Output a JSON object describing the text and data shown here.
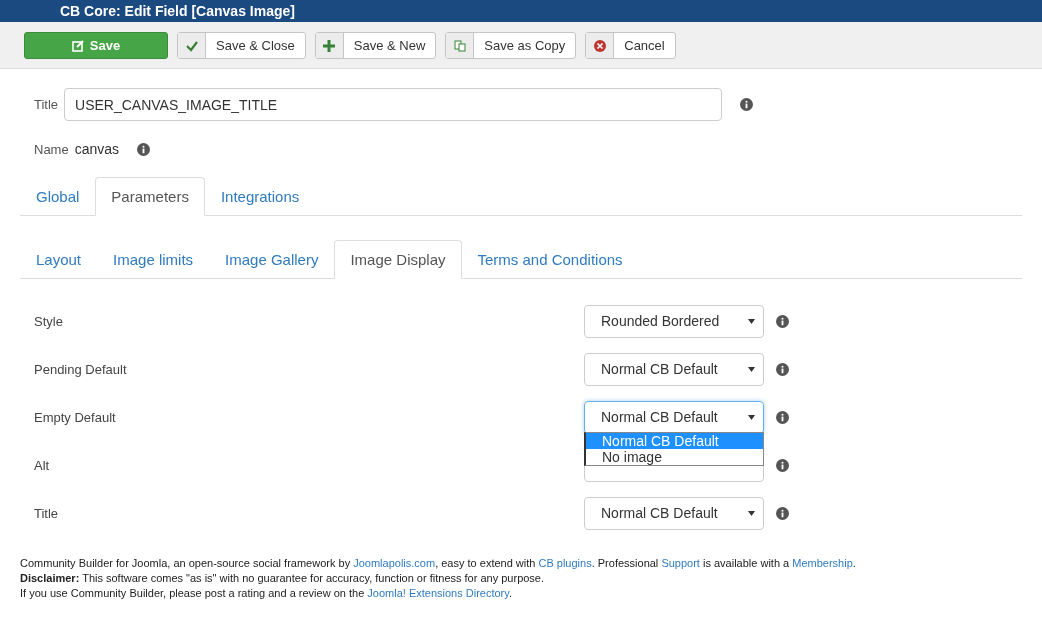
{
  "window": {
    "title": "CB Core: Edit Field [Canvas Image]"
  },
  "toolbar": [
    {
      "label": "Save",
      "kind": "primary"
    },
    {
      "label": "Save & Close",
      "kind": "check"
    },
    {
      "label": "Save & New",
      "kind": "plus"
    },
    {
      "label": "Save as Copy",
      "kind": "copy"
    },
    {
      "label": "Cancel",
      "kind": "cancel"
    }
  ],
  "title_field": {
    "label": "Title",
    "value": "USER_CANVAS_IMAGE_TITLE"
  },
  "name": {
    "label": "Name",
    "value": "canvas"
  },
  "tabs": [
    {
      "label": "Global",
      "selected": false
    },
    {
      "label": "Parameters",
      "selected": true
    },
    {
      "label": "Integrations",
      "selected": false
    }
  ],
  "subtabs": [
    {
      "label": "Layout",
      "selected": false
    },
    {
      "label": "Image limits",
      "selected": false
    },
    {
      "label": "Image Gallery",
      "selected": false
    },
    {
      "label": "Image Display",
      "selected": true
    },
    {
      "label": "Terms and Conditions",
      "selected": false
    }
  ],
  "fields": [
    {
      "label": "Style",
      "value": "Rounded Bordered",
      "focused": false
    },
    {
      "label": "Pending Default",
      "value": "Normal CB Default",
      "focused": false
    },
    {
      "label": "Empty Default",
      "value": "Normal CB Default",
      "focused": true,
      "options": [
        {
          "label": "Normal CB Default",
          "selected": true
        },
        {
          "label": "No image",
          "selected": false
        }
      ]
    },
    {
      "label": "Alt",
      "focused": false
    },
    {
      "label": "Title",
      "value": "Normal CB Default",
      "focused": false
    }
  ],
  "footer": [
    [
      {
        "kind": "text",
        "text": "Community Builder for Joomla, an open-source social framework by "
      },
      {
        "kind": "link",
        "text": "Joomlapolis.com"
      },
      {
        "kind": "text",
        "text": ", easy to extend with "
      },
      {
        "kind": "link",
        "text": "CB plugins"
      },
      {
        "kind": "text",
        "text": ". Professional "
      },
      {
        "kind": "link",
        "text": "Support"
      },
      {
        "kind": "text",
        "text": " is available with a "
      },
      {
        "kind": "link",
        "text": "Membership"
      },
      {
        "kind": "text",
        "text": "."
      }
    ],
    [
      {
        "kind": "text",
        "text": "**Disclaimer:** This software comes \"as is\" with no guarantee for accuracy, function or fitness for any purpose."
      }
    ],
    [
      {
        "kind": "text",
        "text": "If you use Community Builder, please post a rating and a review on the "
      },
      {
        "kind": "link",
        "text": "Joomla! Extensions Directory"
      },
      {
        "kind": "text",
        "text": "."
      }
    ]
  ]
}
